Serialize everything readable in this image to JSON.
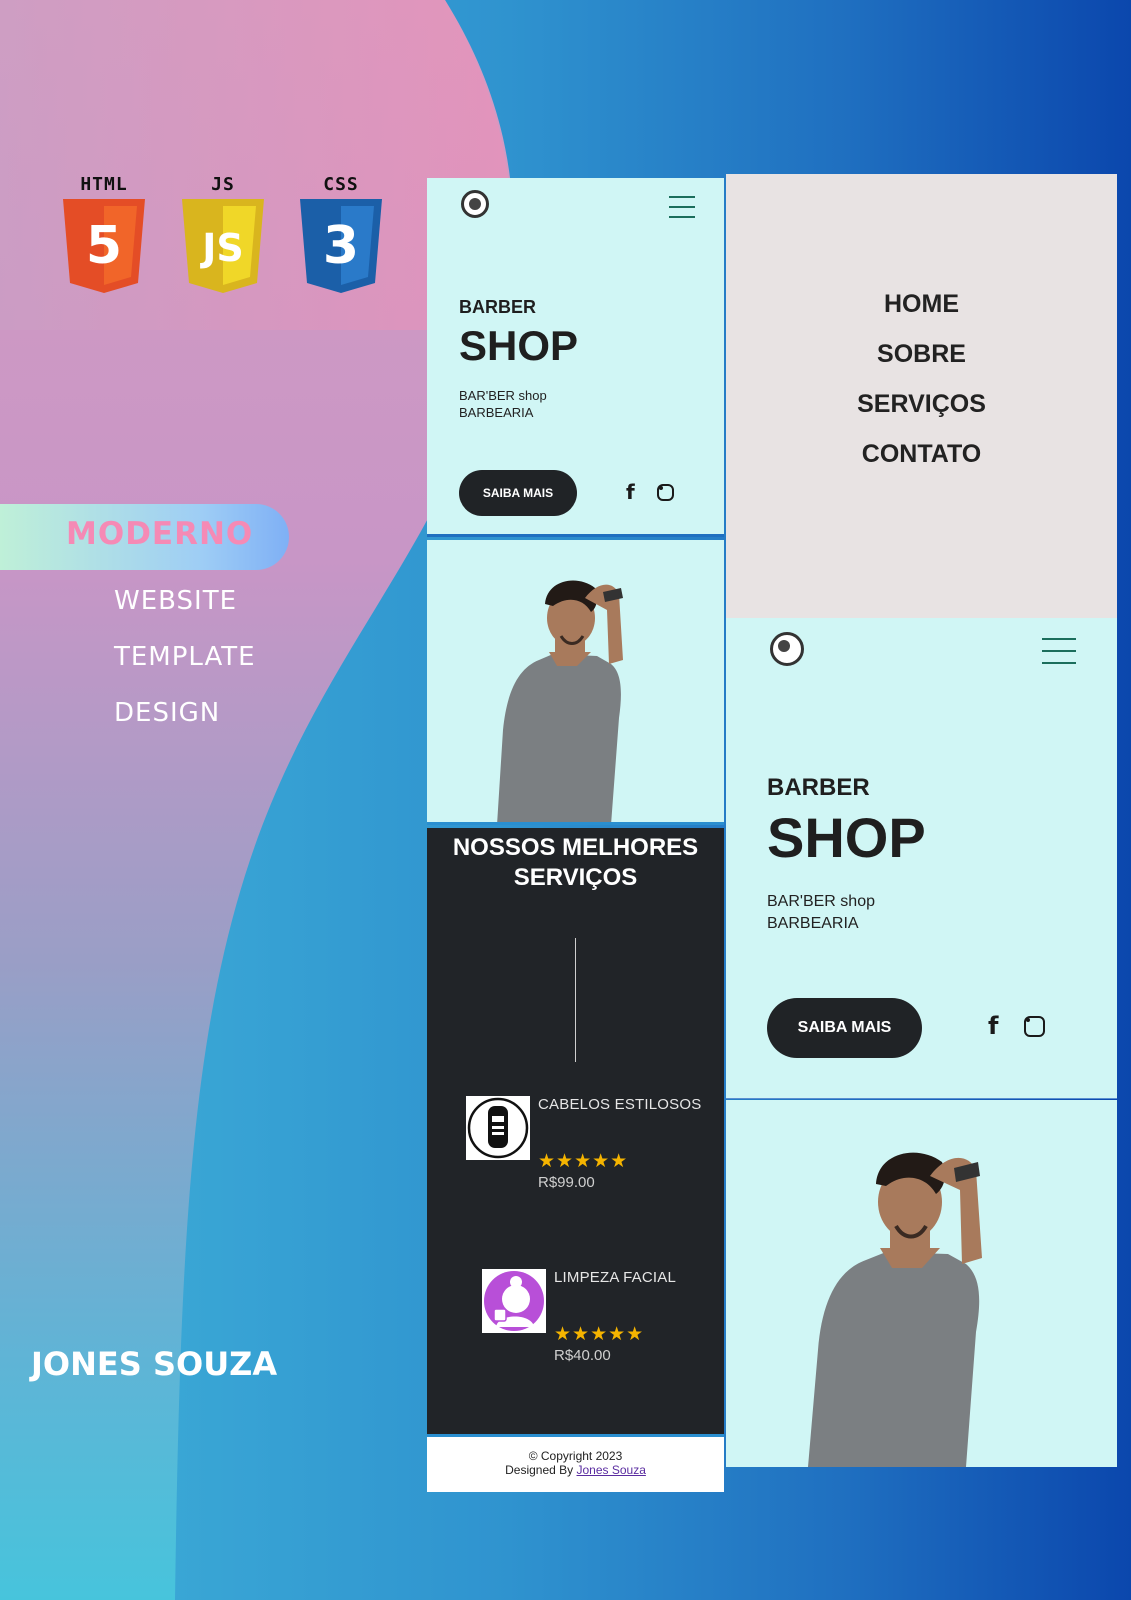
{
  "tech_logos": [
    {
      "label": "HTML",
      "digit": "5",
      "color": "#e44d26"
    },
    {
      "label": "JS",
      "digit": "JS",
      "color": "#f0d728"
    },
    {
      "label": "CSS",
      "digit": "3",
      "color": "#2565b0"
    }
  ],
  "sidebar": {
    "badge": "MODERNO",
    "words": [
      "WEBSITE",
      "TEMPLATE",
      "DESIGN"
    ],
    "author": "JONES SOUZA"
  },
  "mobile_small": {
    "hero": {
      "title_top": "BARBER",
      "title_main": "SHOP",
      "subtitle_1": "BAR'BER shop",
      "subtitle_2": "BARBEARIA",
      "cta": "SAIBA MAIS"
    },
    "services": {
      "title_1": "NOSSOS MELHORES",
      "title_2": "SERVIÇOS",
      "items": [
        {
          "name": "CABELOS ESTILOSOS",
          "stars": "★★★★★",
          "price": "R$99.00",
          "icon": "trimmer-icon"
        },
        {
          "name": "LIMPEZA FACIAL",
          "stars": "★★★★★",
          "price": "R$40.00",
          "icon": "facial-care-icon"
        }
      ]
    },
    "footer": {
      "copyright": "© Copyright 2023",
      "designed_by": "Designed By",
      "author_link": "Jones Souza"
    }
  },
  "menu": {
    "items": [
      "HOME",
      "SOBRE",
      "SERVIÇOS",
      "CONTATO"
    ]
  },
  "mobile_large": {
    "hero": {
      "title_top": "BARBER",
      "title_main": "SHOP",
      "subtitle_1": "BAR'BER shop",
      "subtitle_2": "BARBEARIA",
      "cta": "SAIBA MAIS"
    }
  }
}
